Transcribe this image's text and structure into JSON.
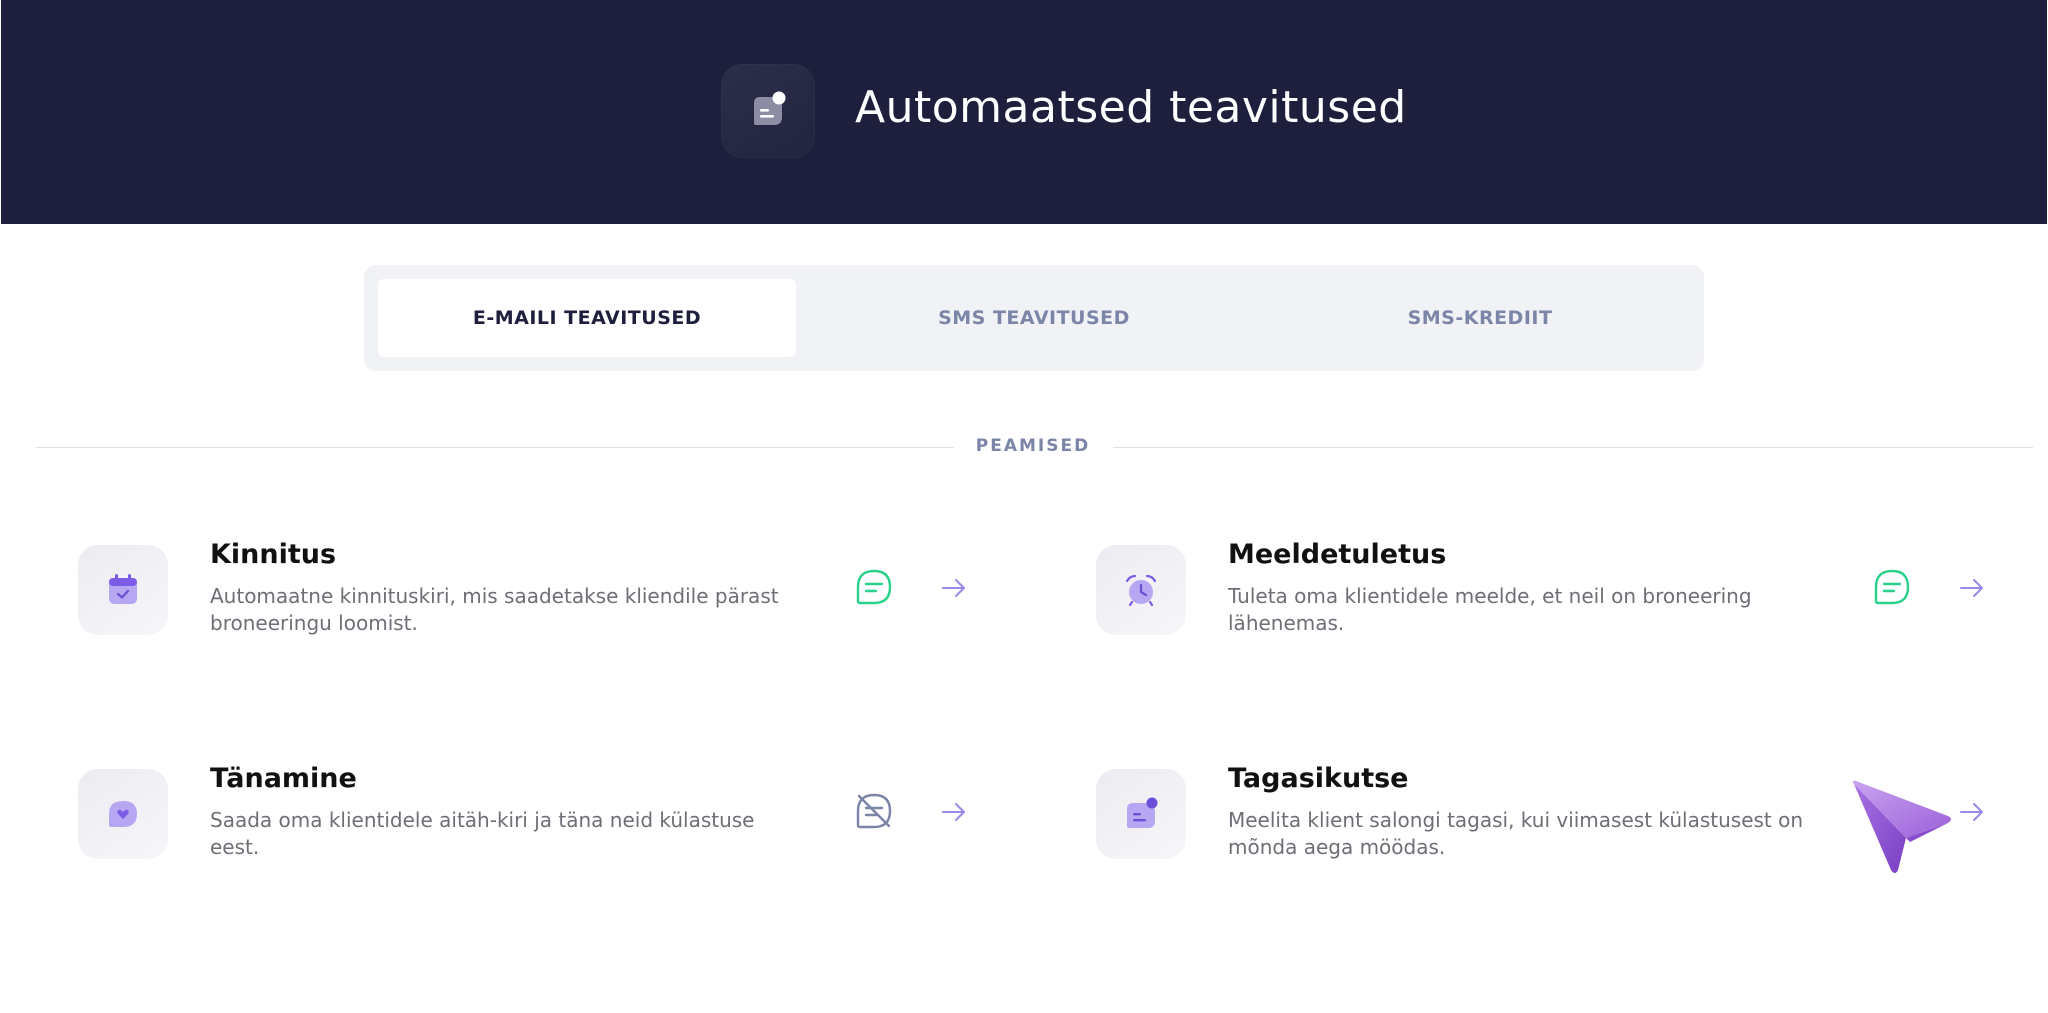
{
  "header": {
    "title": "Automaatsed teavitused",
    "icon": "chat-bubble-notification-icon"
  },
  "tabs": [
    {
      "label": "E-MAILI TEAVITUSED",
      "active": true
    },
    {
      "label": "SMS TEAVITUSED",
      "active": false
    },
    {
      "label": "SMS-KREDIIT",
      "active": false
    }
  ],
  "section": {
    "label": "PEAMISED"
  },
  "cards": [
    {
      "title": "Kinnitus",
      "description": "Automaatne kinnituskiri, mis saadetakse kliendile pärast broneeringu loomist.",
      "icon": "calendar-check-icon",
      "status": "enabled",
      "status_icon": "chat-active-icon"
    },
    {
      "title": "Meeldetuletus",
      "description": "Tuleta oma klientidele meelde, et neil on broneering lähenemas.",
      "icon": "alarm-clock-icon",
      "status": "enabled",
      "status_icon": "chat-active-icon"
    },
    {
      "title": "Tänamine",
      "description": "Saada oma klientidele aitäh-kiri ja täna neid külastuse eest.",
      "icon": "heart-bubble-icon",
      "status": "disabled",
      "status_icon": "chat-disabled-icon"
    },
    {
      "title": "Tagasikutse",
      "description": "Meelita klient salongi tagasi, kui viimasest külastusest on mõnda aega möödas.",
      "icon": "chat-bubble-notification-icon",
      "status": "promo",
      "status_icon": "send-arrow-graphic"
    }
  ],
  "colors": {
    "header_bg": "#1d1f3d",
    "accent_purple": "#7c5ce6",
    "status_green": "#2bd18a",
    "status_gray": "#7b85a8"
  }
}
